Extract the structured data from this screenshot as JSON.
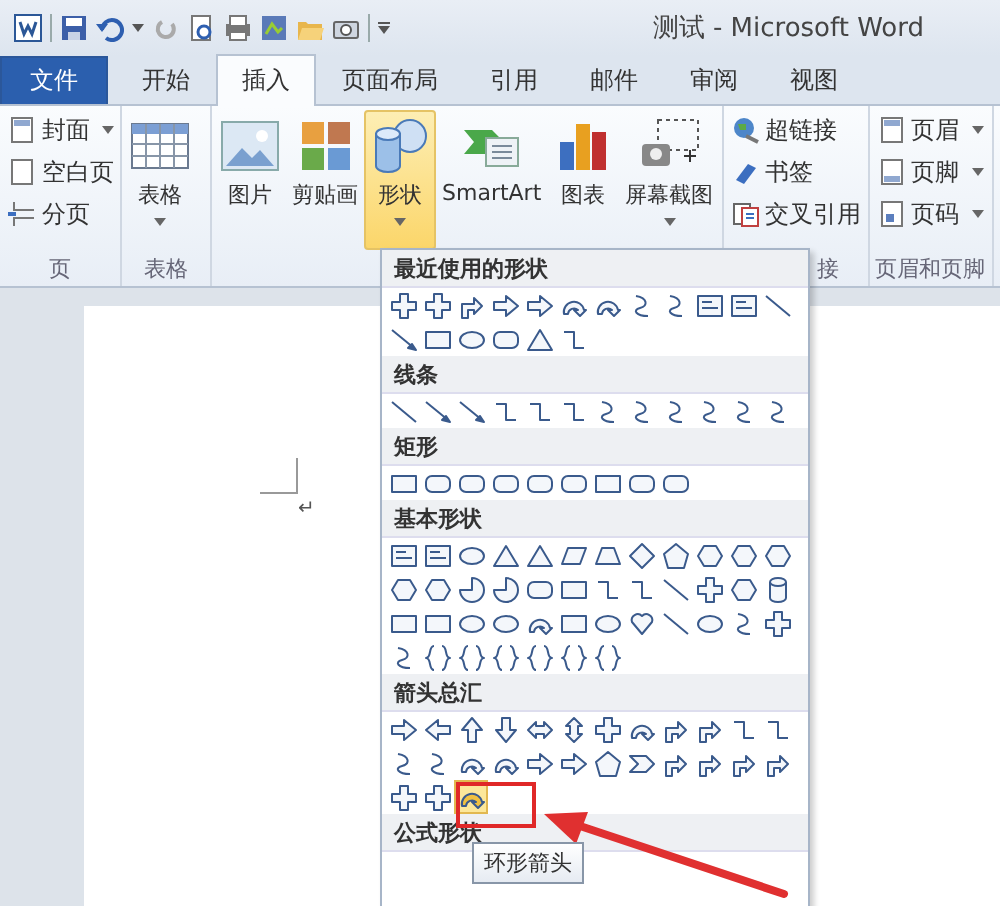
{
  "title_bar": {
    "title": "测试 - Microsoft Word"
  },
  "tabs": [
    {
      "label": "文件",
      "kind": "file",
      "selected": false
    },
    {
      "label": "开始",
      "kind": "tab",
      "selected": false
    },
    {
      "label": "插入",
      "kind": "tab",
      "selected": true
    },
    {
      "label": "页面布局",
      "kind": "tab",
      "selected": false
    },
    {
      "label": "引用",
      "kind": "tab",
      "selected": false
    },
    {
      "label": "邮件",
      "kind": "tab",
      "selected": false
    },
    {
      "label": "审阅",
      "kind": "tab",
      "selected": false
    },
    {
      "label": "视图",
      "kind": "tab",
      "selected": false
    }
  ],
  "ribbon": {
    "groups": [
      {
        "label": "页",
        "kind": "small",
        "buttons": [
          {
            "label": "封面",
            "dropdown": true
          },
          {
            "label": "空白页",
            "dropdown": false
          },
          {
            "label": "分页",
            "dropdown": false
          }
        ]
      },
      {
        "label": "表格",
        "kind": "large",
        "buttons": [
          {
            "label": "表格",
            "dropdown": true,
            "selected": false
          }
        ]
      },
      {
        "kind": "large",
        "buttons": [
          {
            "label": "图片",
            "dropdown": false,
            "selected": false
          },
          {
            "label": "剪贴画",
            "dropdown": false,
            "selected": false
          },
          {
            "label": "形状",
            "dropdown": true,
            "selected": true
          },
          {
            "label": "SmartArt",
            "dropdown": false,
            "selected": false
          },
          {
            "label": "图表",
            "dropdown": false,
            "selected": false
          },
          {
            "label": "屏幕截图",
            "dropdown": true,
            "selected": false
          }
        ]
      },
      {
        "label": "接",
        "kind": "small",
        "buttons": [
          {
            "label": "超链接",
            "dropdown": false
          },
          {
            "label": "书签",
            "dropdown": false
          },
          {
            "label": "交叉引用",
            "dropdown": false
          }
        ]
      },
      {
        "label": "页眉和页脚",
        "kind": "small",
        "buttons": [
          {
            "label": "页眉",
            "dropdown": true
          },
          {
            "label": "页脚",
            "dropdown": true
          },
          {
            "label": "页码",
            "dropdown": true
          }
        ]
      }
    ]
  },
  "document": {
    "paragraph_mark": "↵"
  },
  "gallery": {
    "sections": [
      {
        "title": "最近使用的形状",
        "shapes": [
          {
            "selected": false
          },
          {
            "selected": false
          },
          {
            "selected": false
          },
          {
            "selected": false
          },
          {
            "selected": false
          },
          {
            "selected": false
          },
          {
            "selected": false
          },
          {
            "selected": false
          },
          {
            "selected": false
          },
          {
            "selected": false
          },
          {
            "selected": false
          },
          {
            "selected": false
          },
          {
            "selected": false
          },
          {
            "selected": false
          },
          {
            "selected": false
          },
          {
            "selected": false
          },
          {
            "selected": false
          },
          {
            "selected": false
          }
        ]
      },
      {
        "title": "线条",
        "shapes": [
          {
            "selected": false
          },
          {
            "selected": false
          },
          {
            "selected": false
          },
          {
            "selected": false
          },
          {
            "selected": false
          },
          {
            "selected": false
          },
          {
            "selected": false
          },
          {
            "selected": false
          },
          {
            "selected": false
          },
          {
            "selected": false
          },
          {
            "selected": false
          },
          {
            "selected": false
          }
        ]
      },
      {
        "title": "矩形",
        "shapes": [
          {
            "selected": false
          },
          {
            "selected": false
          },
          {
            "selected": false
          },
          {
            "selected": false
          },
          {
            "selected": false
          },
          {
            "selected": false
          },
          {
            "selected": false
          },
          {
            "selected": false
          },
          {
            "selected": false
          }
        ]
      },
      {
        "title": "基本形状",
        "shapes": [
          {
            "selected": false
          },
          {
            "selected": false
          },
          {
            "selected": false
          },
          {
            "selected": false
          },
          {
            "selected": false
          },
          {
            "selected": false
          },
          {
            "selected": false
          },
          {
            "selected": false
          },
          {
            "selected": false
          },
          {
            "selected": false
          },
          {
            "selected": false
          },
          {
            "selected": false
          },
          {
            "selected": false
          },
          {
            "selected": false
          },
          {
            "selected": false
          },
          {
            "selected": false
          },
          {
            "selected": false
          },
          {
            "selected": false
          },
          {
            "selected": false
          },
          {
            "selected": false
          },
          {
            "selected": false
          },
          {
            "selected": false
          },
          {
            "selected": false
          },
          {
            "selected": false
          },
          {
            "selected": false
          },
          {
            "selected": false
          },
          {
            "selected": false
          },
          {
            "selected": false
          },
          {
            "selected": false
          },
          {
            "selected": false
          },
          {
            "selected": false
          },
          {
            "selected": false
          },
          {
            "selected": false
          },
          {
            "selected": false
          },
          {
            "selected": false
          },
          {
            "selected": false
          },
          {
            "selected": false
          },
          {
            "selected": false
          },
          {
            "selected": false
          },
          {
            "selected": false
          },
          {
            "selected": false
          },
          {
            "selected": false
          },
          {
            "selected": false
          }
        ]
      },
      {
        "title": "箭头总汇",
        "shapes": [
          {
            "selected": false
          },
          {
            "selected": false
          },
          {
            "selected": false
          },
          {
            "selected": false
          },
          {
            "selected": false
          },
          {
            "selected": false
          },
          {
            "selected": false
          },
          {
            "selected": false
          },
          {
            "selected": false
          },
          {
            "selected": false
          },
          {
            "selected": false
          },
          {
            "selected": false
          },
          {
            "selected": false
          },
          {
            "selected": false
          },
          {
            "selected": false
          },
          {
            "selected": false
          },
          {
            "selected": false
          },
          {
            "selected": false
          },
          {
            "selected": false
          },
          {
            "selected": false
          },
          {
            "selected": false
          },
          {
            "selected": false
          },
          {
            "selected": false
          },
          {
            "selected": false
          },
          {
            "selected": false
          },
          {
            "selected": false
          },
          {
            "selected": true
          }
        ]
      },
      {
        "title": "公式形状"
      }
    ]
  },
  "tooltip": {
    "text": "环形箭头"
  }
}
